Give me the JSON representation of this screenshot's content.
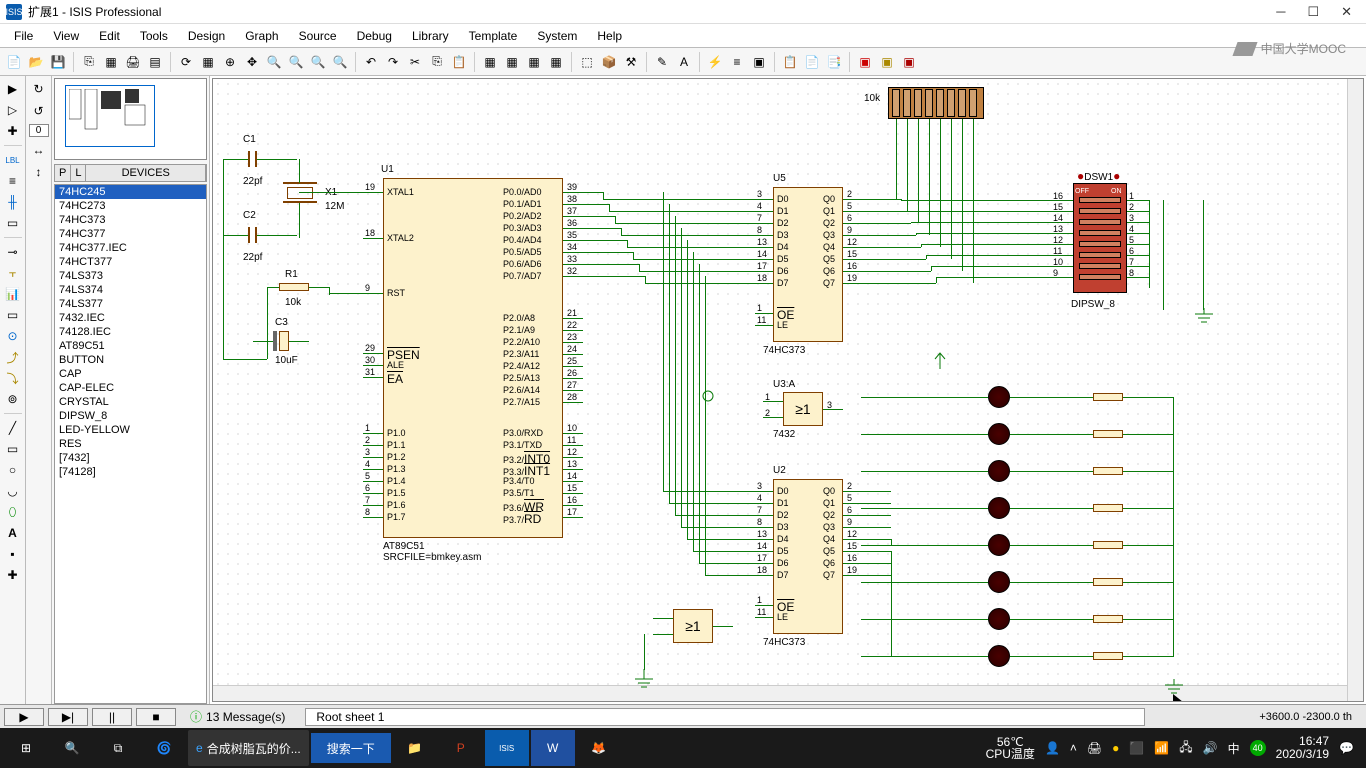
{
  "title": "扩展1 - ISIS Professional",
  "menu": [
    "File",
    "View",
    "Edit",
    "Tools",
    "Design",
    "Graph",
    "Source",
    "Debug",
    "Library",
    "Template",
    "System",
    "Help"
  ],
  "mooc": "中国大学MOOC",
  "deviceHeader": {
    "p": "P",
    "l": "L",
    "label": "DEVICES"
  },
  "devices": [
    "74HC245",
    "74HC273",
    "74HC373",
    "74HC377",
    "74HC377.IEC",
    "74HCT377",
    "74LS373",
    "74LS374",
    "74LS377",
    "7432.IEC",
    "74128.IEC",
    "AT89C51",
    "BUTTON",
    "CAP",
    "CAP-ELEC",
    "CRYSTAL",
    "DIPSW_8",
    "LED-YELLOW",
    "RES",
    "[7432]",
    "[74128]"
  ],
  "selectedDevice": 0,
  "components": {
    "C1": "C1",
    "C1v": "22pf",
    "C2": "C2",
    "C2v": "22pf",
    "C3": "C3",
    "C3v": "10uF",
    "X1": "X1",
    "X1v": "12M",
    "R1": "R1",
    "R1v": "10k",
    "U1": "U1",
    "U1type": "AT89C51",
    "U1src": "SRCFILE=bmkey.asm",
    "U5": "U5",
    "U5type": "74HC373",
    "U2": "U2",
    "U2type": "74HC373",
    "U3A": "U3:A",
    "U3Atype": "7432",
    "DSW1": "DSW1",
    "DSW1type": "DIPSW_8",
    "resnet": "10k",
    "gate_sym": "≥1",
    "dsw_off": "OFF",
    "dsw_on": "ON"
  },
  "u1_pins_left": [
    {
      "num": "19",
      "name": "XTAL1"
    },
    {
      "num": "18",
      "name": "XTAL2"
    },
    {
      "num": "9",
      "name": "RST"
    },
    {
      "num": "29",
      "name": "PSEN",
      "ov": true
    },
    {
      "num": "30",
      "name": "ALE"
    },
    {
      "num": "31",
      "name": "EA",
      "ov": true
    },
    {
      "num": "1",
      "name": "P1.0"
    },
    {
      "num": "2",
      "name": "P1.1"
    },
    {
      "num": "3",
      "name": "P1.2"
    },
    {
      "num": "4",
      "name": "P1.3"
    },
    {
      "num": "5",
      "name": "P1.4"
    },
    {
      "num": "6",
      "name": "P1.5"
    },
    {
      "num": "7",
      "name": "P1.6"
    },
    {
      "num": "8",
      "name": "P1.7"
    }
  ],
  "u1_pins_right": [
    {
      "num": "39",
      "name": "P0.0/AD0"
    },
    {
      "num": "38",
      "name": "P0.1/AD1"
    },
    {
      "num": "37",
      "name": "P0.2/AD2"
    },
    {
      "num": "36",
      "name": "P0.3/AD3"
    },
    {
      "num": "35",
      "name": "P0.4/AD4"
    },
    {
      "num": "34",
      "name": "P0.5/AD5"
    },
    {
      "num": "33",
      "name": "P0.6/AD6"
    },
    {
      "num": "32",
      "name": "P0.7/AD7"
    },
    {
      "num": "21",
      "name": "P2.0/A8"
    },
    {
      "num": "22",
      "name": "P2.1/A9"
    },
    {
      "num": "23",
      "name": "P2.2/A10"
    },
    {
      "num": "24",
      "name": "P2.3/A11"
    },
    {
      "num": "25",
      "name": "P2.4/A12"
    },
    {
      "num": "26",
      "name": "P2.5/A13"
    },
    {
      "num": "27",
      "name": "P2.6/A14"
    },
    {
      "num": "28",
      "name": "P2.7/A15"
    },
    {
      "num": "10",
      "name": "P3.0/RXD"
    },
    {
      "num": "11",
      "name": "P3.1/TXD"
    },
    {
      "num": "12",
      "name": "P3.2/INT0",
      "ov": true
    },
    {
      "num": "13",
      "name": "P3.3/INT1",
      "ov": true
    },
    {
      "num": "14",
      "name": "P3.4/T0"
    },
    {
      "num": "15",
      "name": "P3.5/T1"
    },
    {
      "num": "16",
      "name": "P3.6/WR",
      "ov": true
    },
    {
      "num": "17",
      "name": "P3.7/RD",
      "ov": true
    }
  ],
  "latch_pins": {
    "left": [
      {
        "n": "3",
        "l": "D0"
      },
      {
        "n": "4",
        "l": "D1"
      },
      {
        "n": "7",
        "l": "D2"
      },
      {
        "n": "8",
        "l": "D3"
      },
      {
        "n": "13",
        "l": "D4"
      },
      {
        "n": "14",
        "l": "D5"
      },
      {
        "n": "17",
        "l": "D6"
      },
      {
        "n": "18",
        "l": "D7"
      },
      {
        "n": "1",
        "l": "OE",
        "ov": true
      },
      {
        "n": "11",
        "l": "LE"
      }
    ],
    "right": [
      {
        "n": "2",
        "l": "Q0"
      },
      {
        "n": "5",
        "l": "Q1"
      },
      {
        "n": "6",
        "l": "Q2"
      },
      {
        "n": "9",
        "l": "Q3"
      },
      {
        "n": "12",
        "l": "Q4"
      },
      {
        "n": "15",
        "l": "Q5"
      },
      {
        "n": "16",
        "l": "Q6"
      },
      {
        "n": "19",
        "l": "Q7"
      }
    ]
  },
  "dsw_pins_left": [
    "16",
    "15",
    "14",
    "13",
    "12",
    "11",
    "10",
    "9"
  ],
  "dsw_pins_right": [
    "1",
    "2",
    "3",
    "4",
    "5",
    "6",
    "7",
    "8"
  ],
  "messages": "13 Message(s)",
  "sheet": "Root sheet 1",
  "coords": "+3600.0   -2300.0    th",
  "taskbar": {
    "search_text": "合成树脂瓦的价...",
    "search_btn": "搜索一下",
    "temp": "56℃",
    "temp_label": "CPU温度",
    "ime": "中",
    "time": "16:47",
    "date": "2020/3/19"
  }
}
